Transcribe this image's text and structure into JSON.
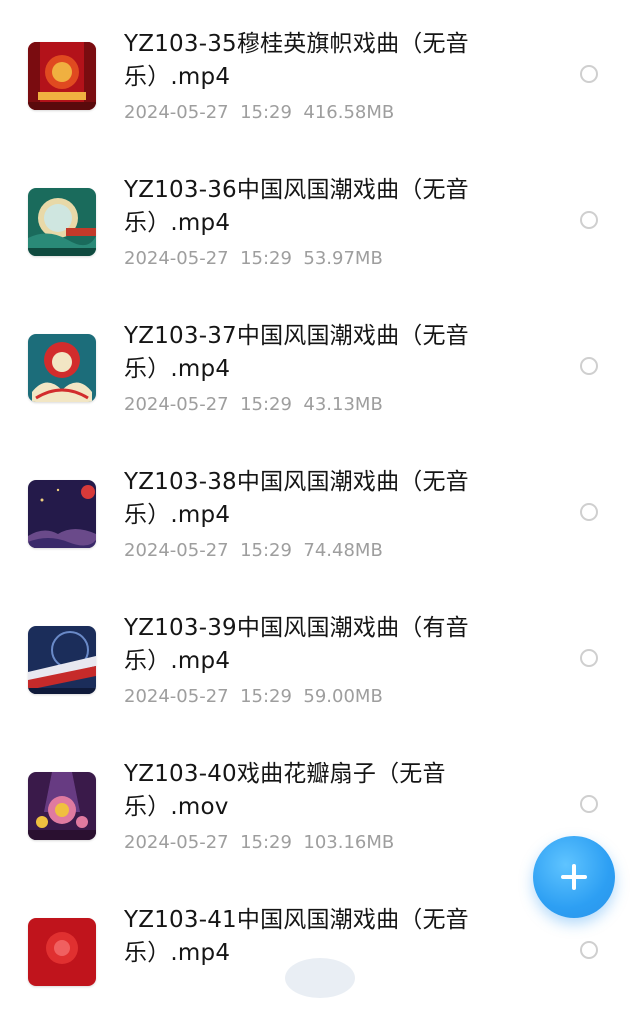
{
  "files": [
    {
      "name": "YZ103-35穆桂英旗帜戏曲（无音乐）.mp4",
      "date": "2024-05-27",
      "time": "15:29",
      "size": "416.58MB",
      "thumb_colors": [
        "#b3121a",
        "#e04a20",
        "#f0b040"
      ]
    },
    {
      "name": "YZ103-36中国风国潮戏曲（无音乐）.mp4",
      "date": "2024-05-27",
      "time": "15:29",
      "size": "53.97MB",
      "thumb_colors": [
        "#1a6b5c",
        "#e8d9a8",
        "#c23a2a"
      ]
    },
    {
      "name": "YZ103-37中国风国潮戏曲（无音乐）.mp4",
      "date": "2024-05-27",
      "time": "15:29",
      "size": "43.13MB",
      "thumb_colors": [
        "#1c6d7a",
        "#d22c2c",
        "#f2e6c4"
      ]
    },
    {
      "name": "YZ103-38中国风国潮戏曲（无音乐）.mp4",
      "date": "2024-05-27",
      "time": "15:29",
      "size": "74.48MB",
      "thumb_colors": [
        "#241a4a",
        "#d83a3a",
        "#6a4a8a"
      ]
    },
    {
      "name": "YZ103-39中国风国潮戏曲（有音乐）.mp4",
      "date": "2024-05-27",
      "time": "15:29",
      "size": "59.00MB",
      "thumb_colors": [
        "#1b2d5a",
        "#c62a2a",
        "#6a8ac8"
      ]
    },
    {
      "name": "YZ103-40戏曲花瓣扇子（无音乐）.mov",
      "date": "2024-05-27",
      "time": "15:29",
      "size": "103.16MB",
      "thumb_colors": [
        "#3a1a4a",
        "#e07aa0",
        "#f0c040"
      ]
    },
    {
      "name": "YZ103-41中国风国潮戏曲（无音乐）.mp4",
      "date": "",
      "time": "",
      "size": "",
      "thumb_colors": [
        "#c0141c",
        "#e03030",
        "#f06060"
      ]
    }
  ],
  "fab": {
    "icon": "plus-icon",
    "color": "#2d9ff3"
  }
}
